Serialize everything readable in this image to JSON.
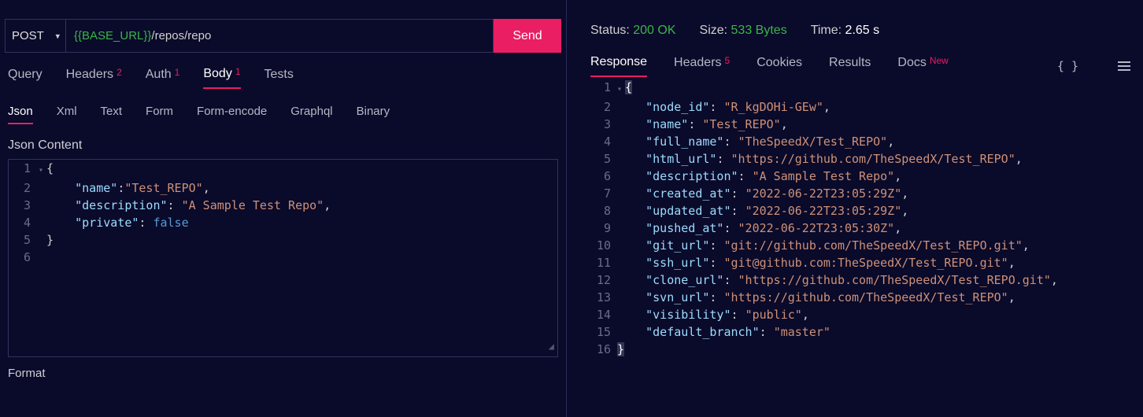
{
  "request": {
    "method": "POST",
    "url_var": "{{BASE_URL}}",
    "url_path": "/repos/repo",
    "send_label": "Send"
  },
  "reqTabs": {
    "query": "Query",
    "headers": "Headers",
    "headers_badge": "2",
    "auth": "Auth",
    "auth_badge": "1",
    "body": "Body",
    "body_badge": "1",
    "tests": "Tests"
  },
  "bodySubtabs": {
    "json": "Json",
    "xml": "Xml",
    "text": "Text",
    "form": "Form",
    "formencode": "Form-encode",
    "graphql": "Graphql",
    "binary": "Binary"
  },
  "body": {
    "heading": "Json Content",
    "format": "Format",
    "lines": {
      "l1_n": "1",
      "l1": "{",
      "l2_n": "2",
      "l2_k": "\"name\"",
      "l2_v": "\"Test_REPO\"",
      "l3_n": "3",
      "l3_k": "\"description\"",
      "l3_v": "\"A Sample Test Repo\"",
      "l4_n": "4",
      "l4_k": "\"private\"",
      "l4_v": "false",
      "l5_n": "5",
      "l5": "}",
      "l6_n": "6"
    }
  },
  "status": {
    "status_lbl": "Status: ",
    "status_val": "200 OK",
    "size_lbl": "Size: ",
    "size_val": "533 Bytes",
    "time_lbl": "Time: ",
    "time_val": "2.65 s"
  },
  "respTabs": {
    "response": "Response",
    "headers": "Headers",
    "headers_badge": "5",
    "cookies": "Cookies",
    "results": "Results",
    "docs": "Docs",
    "docs_badge": "New",
    "braces": "{ }"
  },
  "response": {
    "l1_n": "1",
    "l2_n": "2",
    "l2_k": "\"node_id\"",
    "l2_v": "\"R_kgDOHi-GEw\"",
    "l3_n": "3",
    "l3_k": "\"name\"",
    "l3_v": "\"Test_REPO\"",
    "l4_n": "4",
    "l4_k": "\"full_name\"",
    "l4_v": "\"TheSpeedX/Test_REPO\"",
    "l5_n": "5",
    "l5_k": "\"html_url\"",
    "l5_v": "\"https://github.com/TheSpeedX/Test_REPO\"",
    "l6_n": "6",
    "l6_k": "\"description\"",
    "l6_v": "\"A Sample Test Repo\"",
    "l7_n": "7",
    "l7_k": "\"created_at\"",
    "l7_v": "\"2022-06-22T23:05:29Z\"",
    "l8_n": "8",
    "l8_k": "\"updated_at\"",
    "l8_v": "\"2022-06-22T23:05:29Z\"",
    "l9_n": "9",
    "l9_k": "\"pushed_at\"",
    "l9_v": "\"2022-06-22T23:05:30Z\"",
    "l10_n": "10",
    "l10_k": "\"git_url\"",
    "l10_v": "\"git://github.com/TheSpeedX/Test_REPO.git\"",
    "l11_n": "11",
    "l11_k": "\"ssh_url\"",
    "l11_v": "\"git@github.com:TheSpeedX/Test_REPO.git\"",
    "l12_n": "12",
    "l12_k": "\"clone_url\"",
    "l12_v": "\"https://github.com/TheSpeedX/Test_REPO.git\"",
    "l13_n": "13",
    "l13_k": "\"svn_url\"",
    "l13_v": "\"https://github.com/TheSpeedX/Test_REPO\"",
    "l14_n": "14",
    "l14_k": "\"visibility\"",
    "l14_v": "\"public\"",
    "l15_n": "15",
    "l15_k": "\"default_branch\"",
    "l15_v": "\"master\"",
    "l16_n": "16"
  }
}
